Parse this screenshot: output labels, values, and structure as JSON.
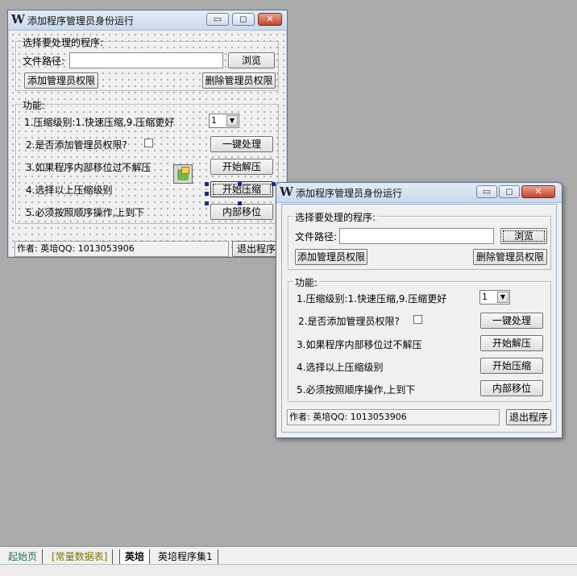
{
  "colors": {
    "background": "#ababab",
    "tab_start": "#207050",
    "tab_const": "#807000"
  },
  "design_window": {
    "title": "添加程序管理员身份运行",
    "group1": {
      "legend": "选择要处理的程序:",
      "path_label": "文件路径:",
      "path_value": "",
      "browse": "浏览",
      "add_admin": "添加管理员权限",
      "remove_admin": "删除管理员权限"
    },
    "group2": {
      "legend": "功能:",
      "item1": "1.压缩级别:1.快速压缩,9.压缩更好",
      "level_value": "1",
      "item2": "2.是否添加管理员权限?",
      "item3": "3.如果程序内部移位过不解压",
      "item4": "4.选择以上压缩级别",
      "item5": "5.必须按照顺序操作,上到下",
      "one_click": "一键处理",
      "decompress": "开始解压",
      "compress": "开始压缩",
      "move": "内部移位"
    },
    "status": "作者: 英培QQ: 1013053906",
    "exit": "退出程序",
    "icons": [
      "app-logo-icon",
      "minimize-icon",
      "maximize-icon",
      "close-icon",
      "component-icon"
    ]
  },
  "runtime_window": {
    "title": "添加程序管理员身份运行",
    "group1": {
      "legend": "选择要处理的程序:",
      "path_label": "文件路径:",
      "path_value": "",
      "browse": "浏览",
      "add_admin": "添加管理员权限",
      "remove_admin": "删除管理员权限"
    },
    "group2": {
      "legend": "功能:",
      "item1": "1.压缩级别:1.快速压缩,9.压缩更好",
      "level_value": "1",
      "item2": "2.是否添加管理员权限?",
      "item3": "3.如果程序内部移位过不解压",
      "item4": "4.选择以上压缩级别",
      "item5": "5.必须按照顺序操作,上到下",
      "one_click": "一键处理",
      "decompress": "开始解压",
      "compress": "开始压缩",
      "move": "内部移位"
    },
    "status": "作者: 英培QQ: 1013053906",
    "exit": "退出程序"
  },
  "tabs": [
    "起始页",
    "[常量数据表]",
    "英培",
    "英培程序集1"
  ]
}
